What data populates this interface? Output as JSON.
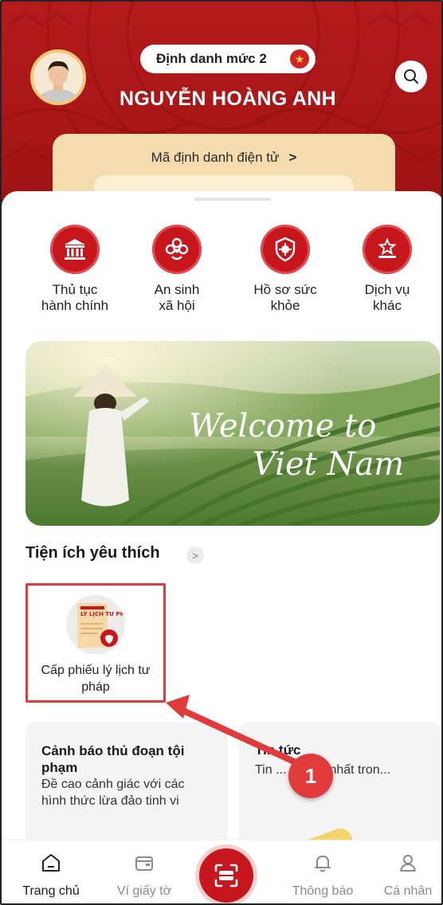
{
  "header": {
    "level_label": "Định danh mức 2",
    "user_name": "NGUYỄN HOÀNG ANH",
    "id_card_label": "Mã định danh điện tử",
    "id_card_chevron": ">"
  },
  "services": [
    {
      "label": "Thủ tục\nhành chính",
      "icon": "government-building-icon"
    },
    {
      "label": "An sinh\nxã hội",
      "icon": "social-welfare-icon"
    },
    {
      "label": "Hồ sơ sức\nkhỏe",
      "icon": "health-shield-icon"
    },
    {
      "label": "Dịch vụ\nkhác",
      "icon": "star-podium-icon"
    }
  ],
  "banner": {
    "line1": "Welcome to",
    "line2": "Viet Nam"
  },
  "favorites": {
    "title": "Tiện ích yêu thích",
    "more": ">",
    "items": [
      {
        "label": "Cấp phiếu lý lịch tư pháp",
        "icon_text": "LÝ LỊCH TƯ PHÁP"
      }
    ]
  },
  "news": [
    {
      "title": "Cảnh báo thủ đoạn tội phạm",
      "desc": "Đề cao cảnh giác với các hình thức lừa đảo tinh vi"
    },
    {
      "title": "Tin tức",
      "desc": "Tin ... ật mới nhất tron..."
    }
  ],
  "annotation": {
    "step": "1"
  },
  "bottom_nav": [
    {
      "label": "Trang chủ",
      "icon": "home-icon",
      "active": true
    },
    {
      "label": "Ví giấy tờ",
      "icon": "wallet-icon",
      "active": false
    },
    {
      "label": "",
      "icon": "scan-icon",
      "active": false
    },
    {
      "label": "Thông báo",
      "icon": "bell-icon",
      "active": false
    },
    {
      "label": "Cá nhân",
      "icon": "person-icon",
      "active": false
    }
  ],
  "colors": {
    "primary": "#c8161d",
    "header": "#b51b1b",
    "id_card": "#f4dcae",
    "annotation": "#e03a3a"
  }
}
